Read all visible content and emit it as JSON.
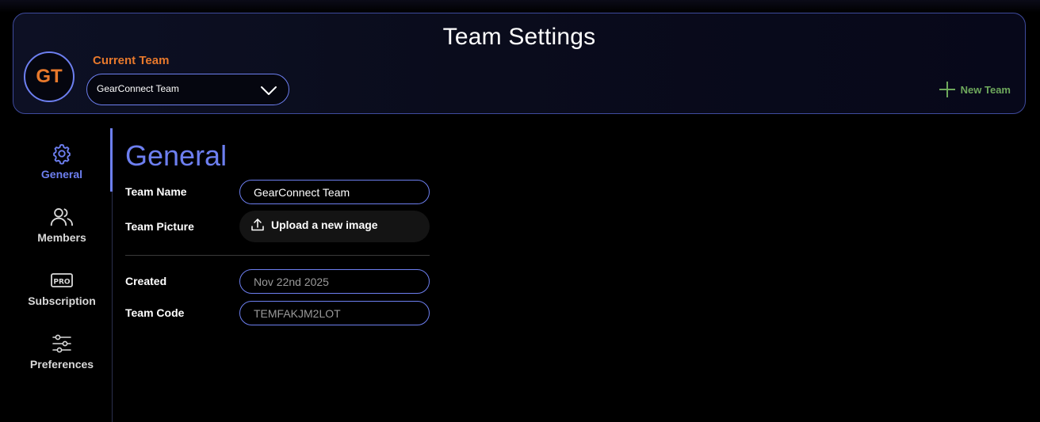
{
  "header": {
    "title": "Team Settings",
    "avatar_initials": "GT",
    "current_team_label": "Current Team",
    "team_select_value": "GearConnect Team",
    "new_team_label": "New Team"
  },
  "sidebar": {
    "items": [
      {
        "label": "General",
        "icon": "gear-icon",
        "active": true
      },
      {
        "label": "Members",
        "icon": "users-icon",
        "active": false
      },
      {
        "label": "Subscription",
        "icon": "pro-badge-icon",
        "active": false
      },
      {
        "label": "Preferences",
        "icon": "sliders-icon",
        "active": false
      }
    ]
  },
  "general": {
    "title": "General",
    "team_name_label": "Team Name",
    "team_name_value": "GearConnect Team",
    "team_picture_label": "Team Picture",
    "upload_label": "Upload a new image",
    "created_label": "Created",
    "created_value": "Nov 22nd 2025",
    "team_code_label": "Team Code",
    "team_code_value": "TEMFAKJM2LOT"
  },
  "colors": {
    "accent": "#6d7ff0",
    "brand_orange": "#e8792c",
    "new_team_green": "#6ea85c",
    "background": "#000000"
  }
}
